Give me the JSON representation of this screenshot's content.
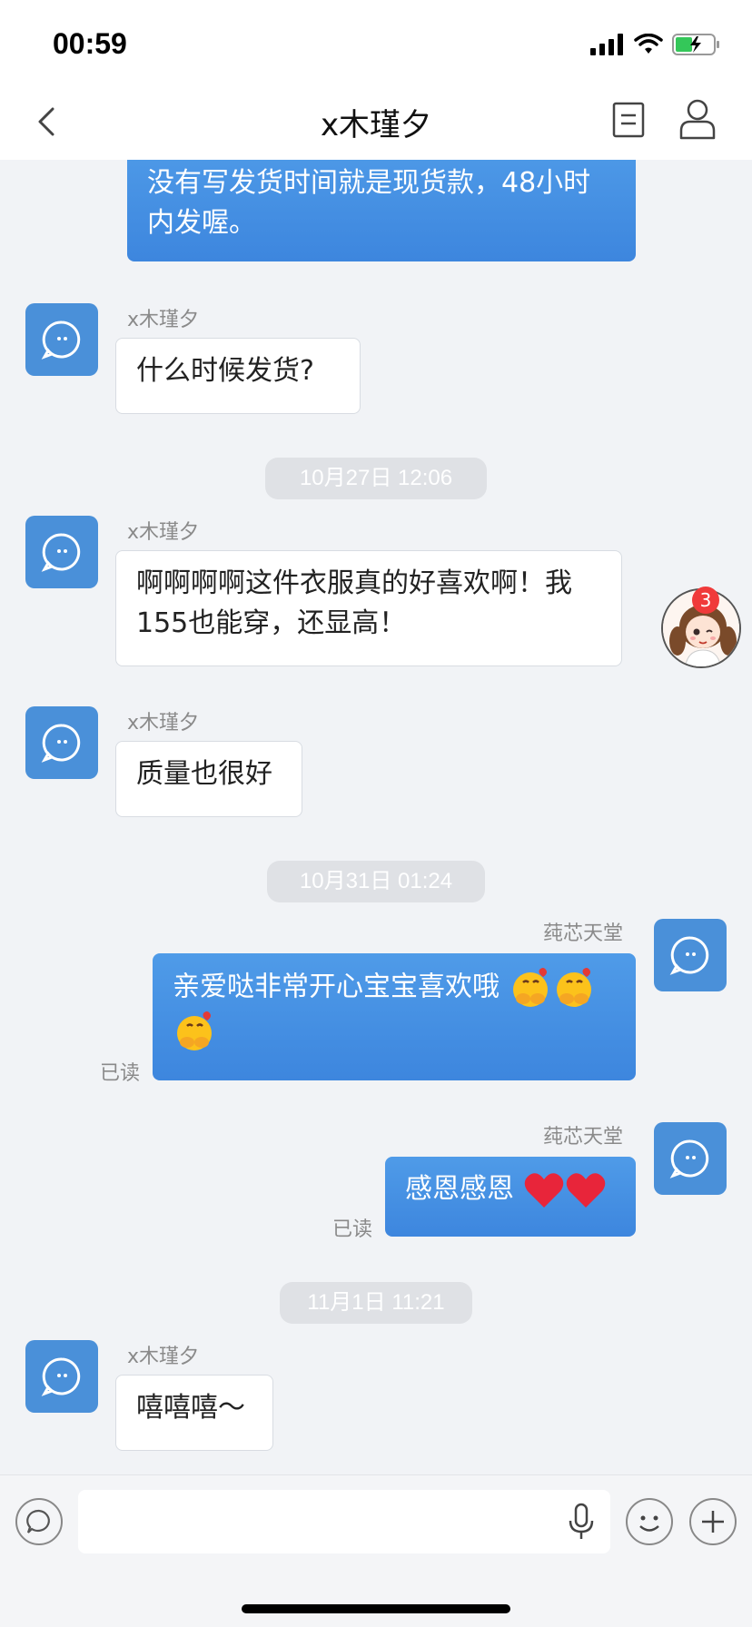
{
  "status_bar": {
    "time": "00:59"
  },
  "nav": {
    "title": "x木瑾夕"
  },
  "messages": {
    "m0": {
      "text": "没有写发货时间就是现货款，48小时内发喔。"
    },
    "m1": {
      "sender": "x木瑾夕",
      "text": "什么时候发货?"
    },
    "ts1": "10月27日 12:06",
    "m2": {
      "sender": "x木瑾夕",
      "text": "啊啊啊啊这件衣服真的好喜欢啊！我155也能穿，还显高！"
    },
    "m3": {
      "sender": "x木瑾夕",
      "text": "质量也很好"
    },
    "ts2": "10月31日 01:24",
    "m4": {
      "sender": "莼芯天堂",
      "text": "亲爱哒非常开心宝宝喜欢哦",
      "status": "已读"
    },
    "m5": {
      "sender": "莼芯天堂",
      "text": "感恩感恩",
      "status": "已读"
    },
    "ts3": "11月1日 11:21",
    "m6": {
      "sender": "x木瑾夕",
      "text": "嘻嘻嘻～"
    }
  },
  "floating": {
    "badge_count": "3"
  },
  "input": {
    "placeholder": ""
  },
  "colors": {
    "accent": "#4a90d9",
    "bubble_out": "#4f9be8",
    "badge": "#f03a3a"
  }
}
